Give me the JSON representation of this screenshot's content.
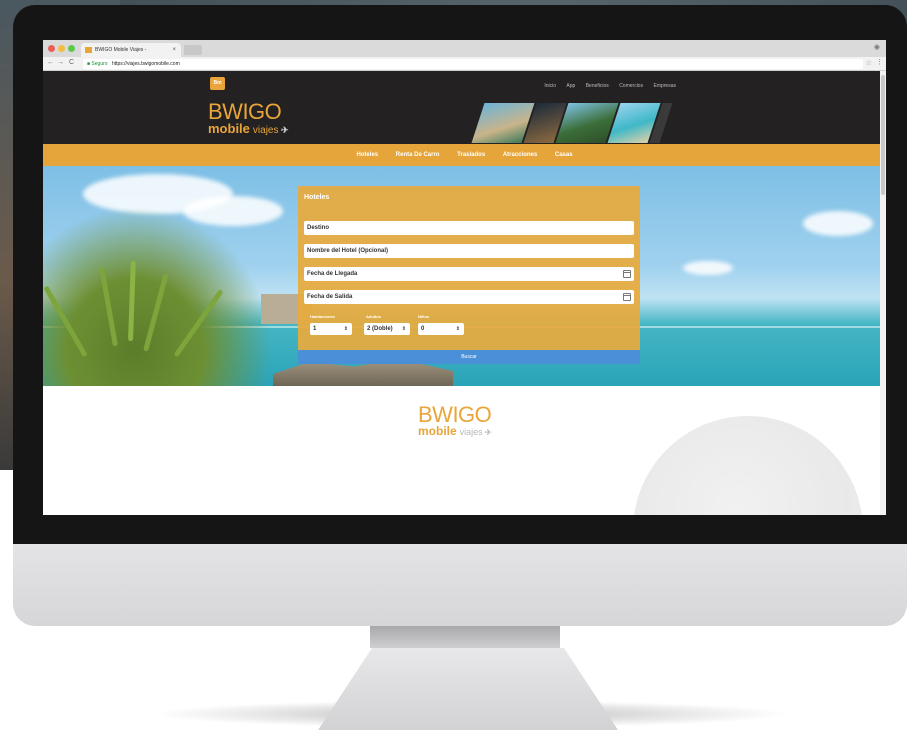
{
  "browser": {
    "tab_title": "BWIGO Mobile Viajes -",
    "tab_close": "×",
    "address": {
      "secure_label": "Seguro",
      "url": "https://viajes.bwigomobile.com"
    }
  },
  "site": {
    "logo_badge": "Bm",
    "logo_main": "BWIGO",
    "logo_sub_bold": "mobile",
    "logo_sub_light": "viajes",
    "top_nav": [
      "Inicio",
      "App",
      "Beneficios",
      "Comercios",
      "Empresas"
    ],
    "main_nav": [
      "Hoteles",
      "Renta De Carro",
      "Traslados",
      "Atracciones",
      "Casas"
    ]
  },
  "search": {
    "title": "Hoteles",
    "fields": {
      "destino": "Destino",
      "hotel_name": "Nombre del Hotel (Opcional)",
      "arrival": "Fecha de Llegada",
      "departure": "Fecha de Salida"
    },
    "labels": {
      "habitaciones": "Habitaciones",
      "adultos": "Adultos",
      "ninos": "Niños"
    },
    "values": {
      "habitaciones": "1",
      "adultos": "2 (Doble)",
      "ninos": "0"
    },
    "button": "Buscar"
  },
  "footer_logo": {
    "main": "BWIGO",
    "sub_bold": "mobile",
    "sub_light": "viajes"
  },
  "colors": {
    "brand_orange": "#e6a53a",
    "header_dark": "#232122",
    "button_blue": "#4a90d9"
  }
}
